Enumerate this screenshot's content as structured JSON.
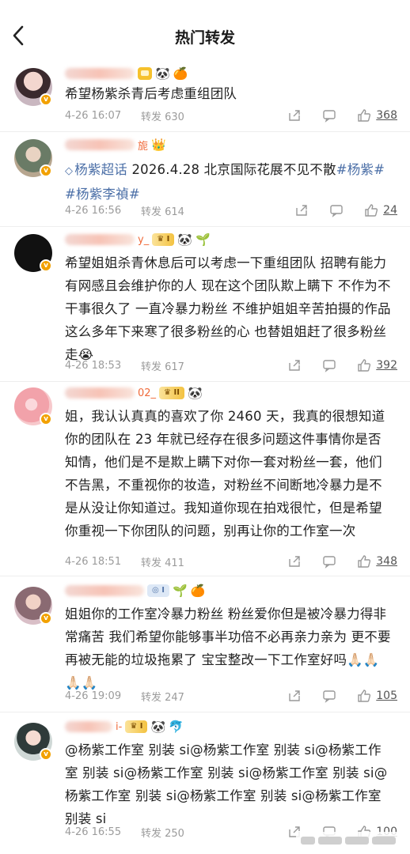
{
  "header": {
    "title": "热门转发"
  },
  "posts": [
    {
      "name_tail": "",
      "text": "希望杨紫杀青后考虑重组团队",
      "date": "4-26 16:07",
      "forward": "转发 630",
      "likes": "368"
    },
    {
      "name_tail": "旎",
      "topic_prefix": "杨紫超话",
      "text_mid": " 2026.4.28 北京国际花展不见不散",
      "tag1": "#杨紫#",
      "tag2": "#杨紫李禎#",
      "date": "4-26 16:56",
      "forward": "转发 614",
      "likes": "24"
    },
    {
      "name_tail": "y_",
      "text": "希望姐姐杀青休息后可以考虑一下重组团队 招聘有能力有网感且会维护你的人 现在这个团队欺上瞒下 不作为不干事很久了 一直冷暴力粉丝 不维护姐姐辛苦拍摄的作品 这么多年下来寒了很多粉丝的心 也替姐姐赶了很多粉丝走😭",
      "date": "4-26 18:53",
      "forward": "转发 617",
      "likes": "392"
    },
    {
      "name_tail": "02_",
      "text": "姐，我认认真真的喜欢了你 2460 天，我真的很想知道你的团队在 23 年就已经存在很多问题这件事情你是否知情，他们是不是欺上瞒下对你一套对粉丝一套，他们不告黑，不重视你的妆造，对粉丝不间断地冷暴力是不是从没让你知道过。我知道你现在拍戏很忙，但是希望你重视一下你团队的问题，别再让你的工作室一次",
      "date": "4-26 18:51",
      "forward": "转发 411",
      "likes": "348"
    },
    {
      "name_tail": "",
      "text": "姐姐你的工作室冷暴力粉丝 粉丝爱你但是被冷暴力得非常痛苦 我们希望你能够事半功倍不必再亲力亲为 更不要再被无能的垃圾拖累了 宝宝整改一下工作室好吗🙏🏻🙏🏻🙏🏻🙏🏻",
      "date": "4-26 19:09",
      "forward": "转发 247",
      "likes": "105"
    },
    {
      "name_tail": "i-",
      "text": "@杨紫工作室 别装 si@杨紫工作室 别装 si@杨紫工作室 别装 si@杨紫工作室 别装 si@杨紫工作室 别装 si@杨紫工作室 别装 si@杨紫工作室 别装 si@杨紫工作室 别装 si",
      "date": "4-26 16:55",
      "forward": "转发 250",
      "likes": "100"
    }
  ],
  "icons": {
    "back": "chevron-left-icon",
    "share": "share-icon",
    "comment": "comment-icon",
    "like": "thumbs-up-icon"
  },
  "colors": {
    "topic": "#4b6fa7",
    "meta": "#9b9b9b",
    "verified": "#f2a100"
  }
}
